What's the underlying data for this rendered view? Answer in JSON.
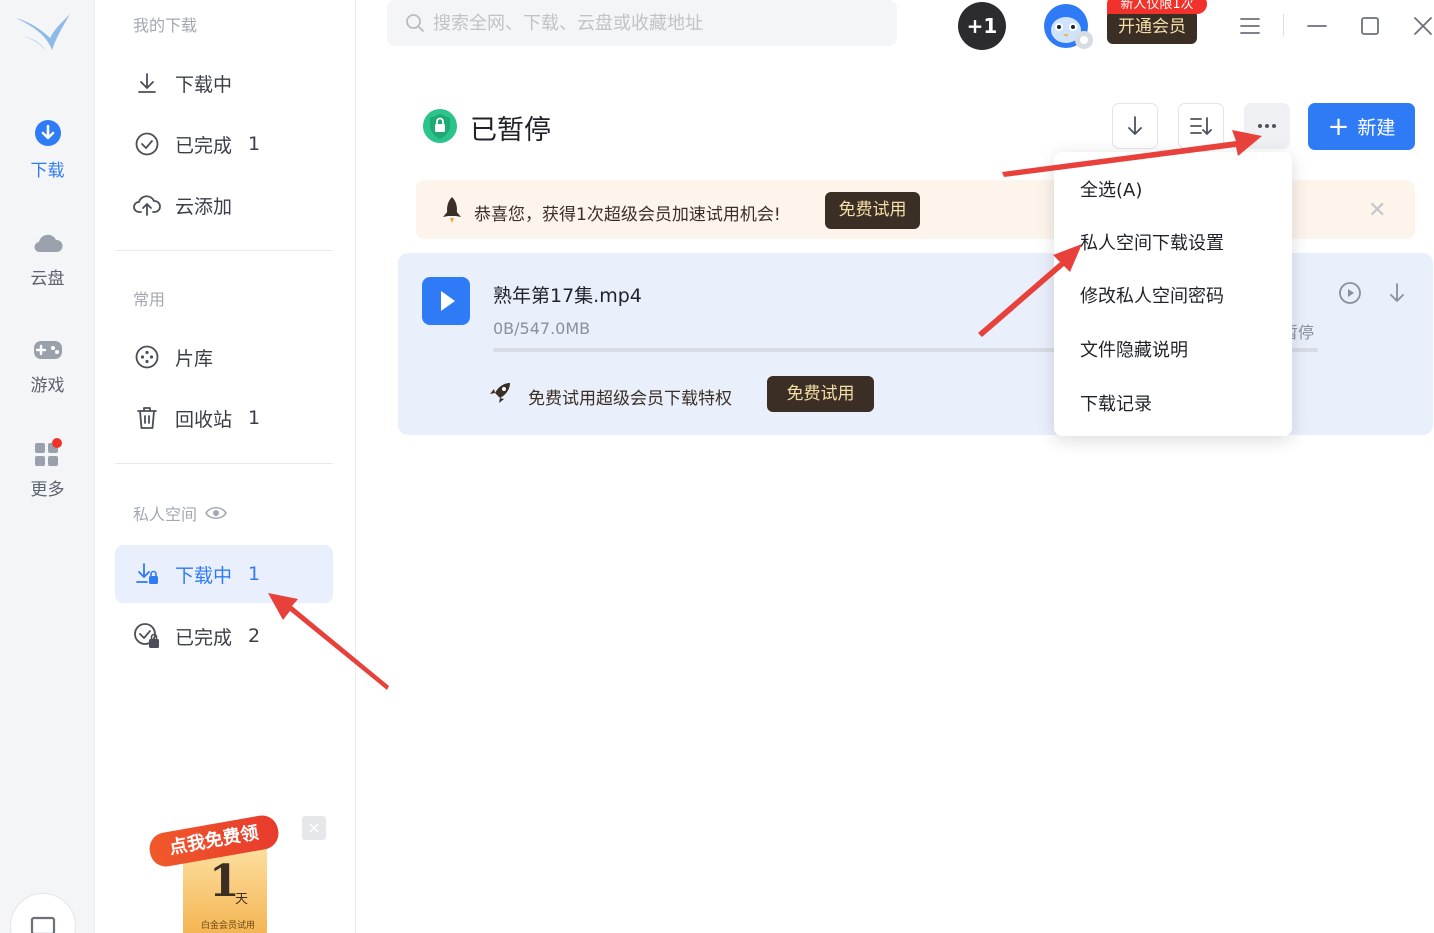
{
  "rail": {
    "items": [
      {
        "label": "下载",
        "icon": "download-circle-icon"
      },
      {
        "label": "云盘",
        "icon": "cloud-icon"
      },
      {
        "label": "游戏",
        "icon": "gamepad-icon"
      },
      {
        "label": "更多",
        "icon": "grid-more-icon"
      }
    ],
    "accent": "#2f7bf5",
    "badge_color": "#f0322a"
  },
  "sidebar": {
    "my_downloads_title": "我的下载",
    "my_downloads": [
      {
        "label": "下载中",
        "count": "",
        "icon": "download-arrow-icon"
      },
      {
        "label": "已完成",
        "count": "1",
        "icon": "check-circle-icon"
      },
      {
        "label": "云添加",
        "count": "",
        "icon": "cloud-upload-icon"
      }
    ],
    "common_title": "常用",
    "common": [
      {
        "label": "片库",
        "count": "",
        "icon": "film-reel-icon"
      },
      {
        "label": "回收站",
        "count": "1",
        "icon": "trash-icon"
      }
    ],
    "private_title": "私人空间",
    "private": [
      {
        "label": "下载中",
        "count": "1",
        "icon": "download-lock-icon"
      },
      {
        "label": "已完成",
        "count": "2",
        "icon": "check-lock-icon"
      }
    ],
    "promo": {
      "ribbon": "点我免费领",
      "number": "1",
      "unit": "天",
      "sub": "白金会员试用"
    }
  },
  "topbar": {
    "search_placeholder": "搜索全网、下载、云盘或收藏地址",
    "plus_one": "+1",
    "vip_button": "开通会员",
    "vip_tag": "新人仅限1次"
  },
  "content": {
    "title": "已暂停",
    "new_button": "新建",
    "banner": {
      "text": "恭喜您，获得1次超级会员加速试用机会!",
      "button": "免费试用"
    },
    "task": {
      "name": "熟年第17集.mp4",
      "size": "0B/547.0MB",
      "status": "暂停",
      "progress": 0,
      "promo_text": "免费试用超级会员下载特权",
      "promo_button": "免费试用"
    }
  },
  "menu": {
    "items": [
      "全选(A)",
      "私人空间下载设置",
      "修改私人空间密码",
      "文件隐藏说明",
      "下载记录"
    ]
  },
  "colors": {
    "arrow": "#e8413b",
    "vip_dark": "#3a2e25",
    "vip_gold": "#f6dfa8"
  }
}
